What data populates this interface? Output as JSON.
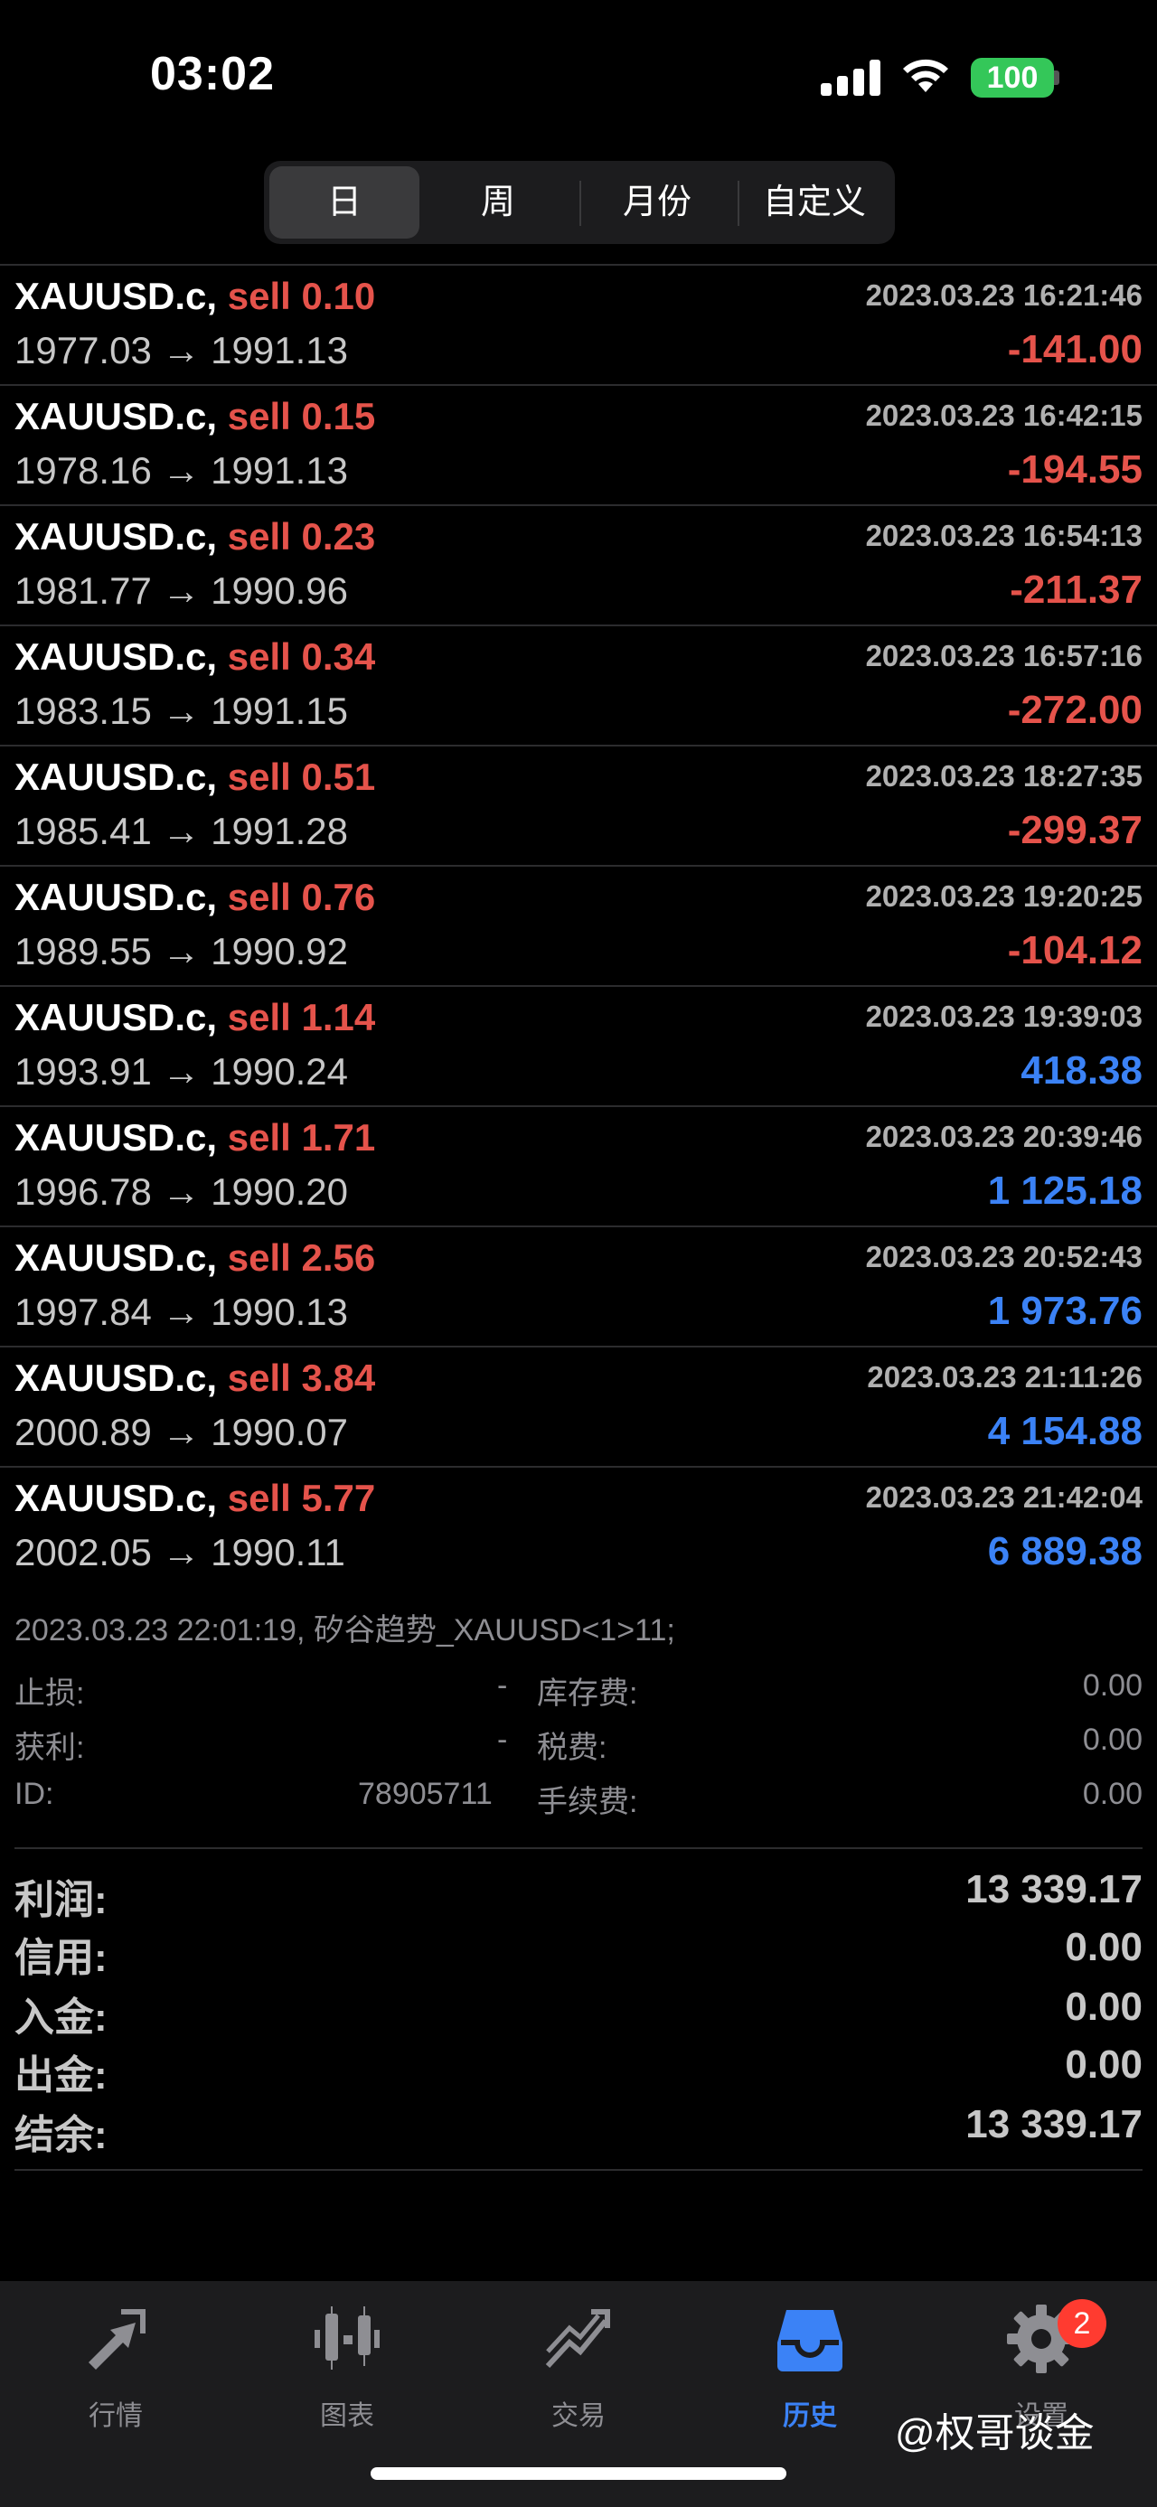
{
  "status_bar": {
    "time": "03:02",
    "battery": "100"
  },
  "segments": [
    "日",
    "周",
    "月份",
    "自定义"
  ],
  "active_segment": 0,
  "trades": [
    {
      "symbol": "XAUUSD.c,",
      "side": "sell",
      "volume": "0.10",
      "time": "2023.03.23 16:21:46",
      "open": "1977.03",
      "close": "1991.13",
      "profit": "-141.00",
      "profit_sign": "neg"
    },
    {
      "symbol": "XAUUSD.c,",
      "side": "sell",
      "volume": "0.15",
      "time": "2023.03.23 16:42:15",
      "open": "1978.16",
      "close": "1991.13",
      "profit": "-194.55",
      "profit_sign": "neg"
    },
    {
      "symbol": "XAUUSD.c,",
      "side": "sell",
      "volume": "0.23",
      "time": "2023.03.23 16:54:13",
      "open": "1981.77",
      "close": "1990.96",
      "profit": "-211.37",
      "profit_sign": "neg"
    },
    {
      "symbol": "XAUUSD.c,",
      "side": "sell",
      "volume": "0.34",
      "time": "2023.03.23 16:57:16",
      "open": "1983.15",
      "close": "1991.15",
      "profit": "-272.00",
      "profit_sign": "neg"
    },
    {
      "symbol": "XAUUSD.c,",
      "side": "sell",
      "volume": "0.51",
      "time": "2023.03.23 18:27:35",
      "open": "1985.41",
      "close": "1991.28",
      "profit": "-299.37",
      "profit_sign": "neg"
    },
    {
      "symbol": "XAUUSD.c,",
      "side": "sell",
      "volume": "0.76",
      "time": "2023.03.23 19:20:25",
      "open": "1989.55",
      "close": "1990.92",
      "profit": "-104.12",
      "profit_sign": "neg"
    },
    {
      "symbol": "XAUUSD.c,",
      "side": "sell",
      "volume": "1.14",
      "time": "2023.03.23 19:39:03",
      "open": "1993.91",
      "close": "1990.24",
      "profit": "418.38",
      "profit_sign": "pos"
    },
    {
      "symbol": "XAUUSD.c,",
      "side": "sell",
      "volume": "1.71",
      "time": "2023.03.23 20:39:46",
      "open": "1996.78",
      "close": "1990.20",
      "profit": "1 125.18",
      "profit_sign": "pos"
    },
    {
      "symbol": "XAUUSD.c,",
      "side": "sell",
      "volume": "2.56",
      "time": "2023.03.23 20:52:43",
      "open": "1997.84",
      "close": "1990.13",
      "profit": "1 973.76",
      "profit_sign": "pos"
    },
    {
      "symbol": "XAUUSD.c,",
      "side": "sell",
      "volume": "3.84",
      "time": "2023.03.23 21:11:26",
      "open": "2000.89",
      "close": "1990.07",
      "profit": "4 154.88",
      "profit_sign": "pos"
    },
    {
      "symbol": "XAUUSD.c,",
      "side": "sell",
      "volume": "5.77",
      "time": "2023.03.23 21:42:04",
      "open": "2002.05",
      "close": "1990.11",
      "profit": "6 889.38",
      "profit_sign": "pos"
    }
  ],
  "arrow": "→",
  "detail": {
    "header": "2023.03.23 22:01:19, 矽谷趋势_XAUUSD<1>11;",
    "stop_loss_label": "止损:",
    "stop_loss_value": "-",
    "take_profit_label": "获利:",
    "take_profit_value": "-",
    "id_label": "ID:",
    "id_value": "78905711",
    "swap_label": "库存费:",
    "swap_value": "0.00",
    "tax_label": "税费:",
    "tax_value": "0.00",
    "fee_label": "手续费:",
    "fee_value": "0.00"
  },
  "summary": [
    {
      "label": "利润:",
      "value": "13 339.17"
    },
    {
      "label": "信用:",
      "value": "0.00"
    },
    {
      "label": "入金:",
      "value": "0.00"
    },
    {
      "label": "出金:",
      "value": "0.00"
    },
    {
      "label": "结余:",
      "value": "13 339.17"
    }
  ],
  "tabs": [
    {
      "label": "行情",
      "icon": "quotes-icon"
    },
    {
      "label": "图表",
      "icon": "candlestick-chart-icon"
    },
    {
      "label": "交易",
      "icon": "trade-chart-icon"
    },
    {
      "label": "历史",
      "icon": "history-inbox-icon"
    },
    {
      "label": "设置",
      "icon": "gear-icon"
    }
  ],
  "active_tab": 3,
  "settings_badge": "2",
  "watermark": "@权哥谈金",
  "colors": {
    "loss": "#e5534b",
    "gain": "#3b82f6",
    "accent": "#3b82f6",
    "battery": "#34c759"
  }
}
